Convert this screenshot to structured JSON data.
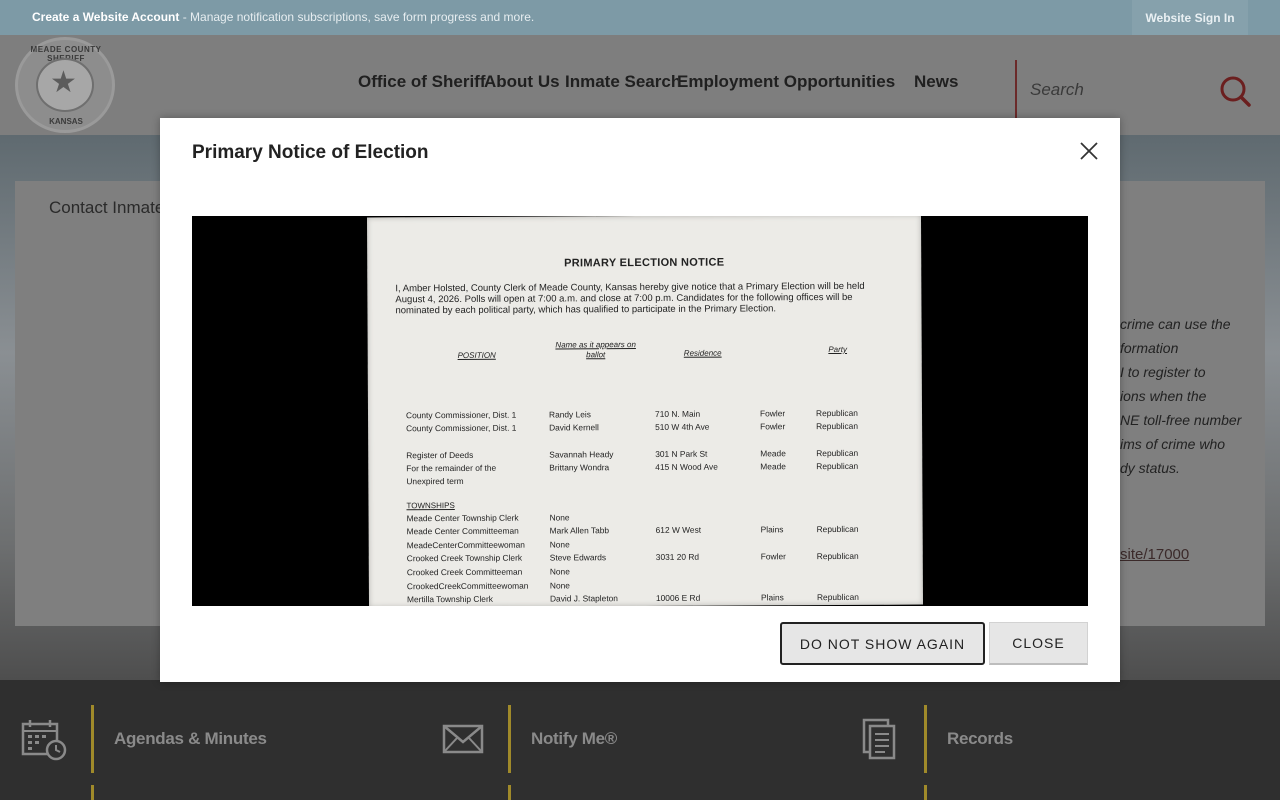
{
  "topbar": {
    "account_link": "Create a Website Account",
    "account_desc": " - Manage notification subscriptions, save form progress and more.",
    "sign_in": "Website Sign In"
  },
  "logo": {
    "top_text": "MEADE COUNTY SHERIFF",
    "bottom_text": "KANSAS"
  },
  "nav": {
    "items": [
      "Office of Sheriff",
      "About Us",
      "Inmate Search",
      "Employment Opportunities",
      "News"
    ]
  },
  "search": {
    "placeholder": "Search"
  },
  "content": {
    "breadcrumb": "Contact Inmate",
    "side_lines": [
      "crime can use the",
      "formation",
      "I to register to",
      "ions when the",
      "NE toll-free number",
      "ims of crime who",
      "dy status."
    ],
    "side_link": "site/17000"
  },
  "footer": {
    "items": [
      {
        "label": "Agendas & Minutes",
        "icon": "calendar-clock-icon"
      },
      {
        "label": "Notify Me®",
        "icon": "envelope-icon"
      },
      {
        "label": "Records",
        "icon": "documents-icon"
      }
    ]
  },
  "modal": {
    "title": "Primary Notice of Election",
    "buttons": {
      "do_not_show": "DO NOT SHOW AGAIN",
      "close": "CLOSE"
    },
    "notice": {
      "title": "PRIMARY ELECTION NOTICE",
      "intro": "I, Amber Holsted, County Clerk of Meade County, Kansas hereby give notice that a Primary Election will be held August 4, 2026. Polls will open at 7:00 a.m. and close at 7:00 p.m. Candidates for the following offices will be nominated by each political party, which has qualified to participate in the Primary Election.",
      "headers": {
        "position": "POSITION",
        "name": "Name as it appears on ballot",
        "residence": "Residence",
        "party": "Party"
      },
      "section": "TOWNSHIPS",
      "rows": [
        {
          "position": "County Commissioner, Dist. 1",
          "name": "Randy Leis",
          "residence": "710 N. Main",
          "city": "Fowler",
          "party": "Republican"
        },
        {
          "position": "County Commissioner, Dist. 1",
          "name": "David Kernell",
          "residence": "510 W 4th Ave",
          "city": "Fowler",
          "party": "Republican"
        },
        {
          "position": "Register of Deeds",
          "name": "Savannah Heady",
          "residence": "301 N Park St",
          "city": "Meade",
          "party": "Republican"
        },
        {
          "position": "For the remainder of the",
          "name": "Brittany Wondra",
          "residence": "415 N Wood Ave",
          "city": "Meade",
          "party": "Republican"
        },
        {
          "position": "Unexpired term",
          "name": "",
          "residence": "",
          "city": "",
          "party": ""
        },
        {
          "position": "Meade Center Township Clerk",
          "name": "None",
          "residence": "",
          "city": "",
          "party": ""
        },
        {
          "position": "Meade Center Committeeman",
          "name": "Mark Allen Tabb",
          "residence": "612 W West",
          "city": "Plains",
          "party": "Republican"
        },
        {
          "position": "MeadeCenterCommitteewoman",
          "name": "None",
          "residence": "",
          "city": "",
          "party": ""
        },
        {
          "position": "Crooked Creek Township Clerk",
          "name": "Steve Edwards",
          "residence": "3031 20 Rd",
          "city": "Fowler",
          "party": "Republican"
        },
        {
          "position": "Crooked Creek Committeeman",
          "name": "None",
          "residence": "",
          "city": "",
          "party": ""
        },
        {
          "position": "CrookedCreekCommitteewoman",
          "name": "None",
          "residence": "",
          "city": "",
          "party": ""
        },
        {
          "position": "Mertilla Township Clerk",
          "name": "David J. Stapleton",
          "residence": "10006 E Rd",
          "city": "Plains",
          "party": "Republican"
        }
      ]
    }
  }
}
